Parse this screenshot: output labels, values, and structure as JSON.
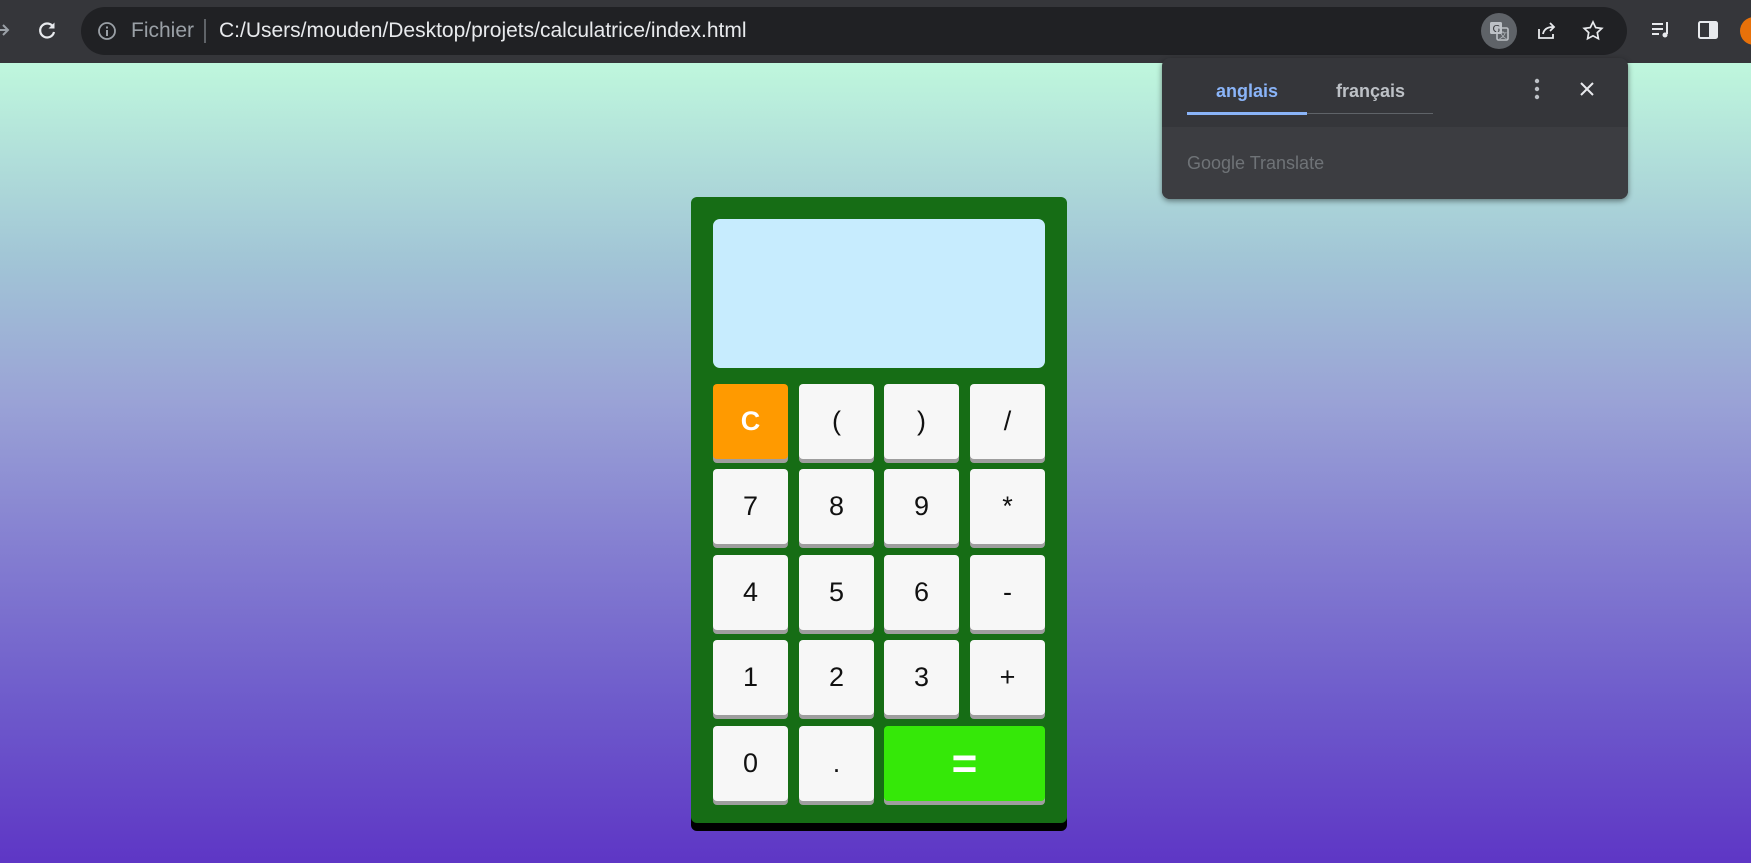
{
  "browser": {
    "scheme_label": "Fichier",
    "url": "C:/Users/mouden/Desktop/projets/calculatrice/index.html"
  },
  "translate_popup": {
    "source_language": "anglais",
    "target_language": "français",
    "brand": "Google Translate"
  },
  "calculator": {
    "display_value": "",
    "keys": {
      "clear": "C",
      "open_paren": "(",
      "close_paren": ")",
      "divide": "/",
      "seven": "7",
      "eight": "8",
      "nine": "9",
      "multiply": "*",
      "four": "4",
      "five": "5",
      "six": "6",
      "minus": "-",
      "one": "1",
      "two": "2",
      "three": "3",
      "plus": "+",
      "zero": "0",
      "dot": ".",
      "equals": "="
    },
    "colors": {
      "body": "#166d15",
      "display": "#c7ecfe",
      "clear_key": "#ff9a00",
      "equals_key": "#35e808",
      "key": "#f7f7f7"
    }
  }
}
